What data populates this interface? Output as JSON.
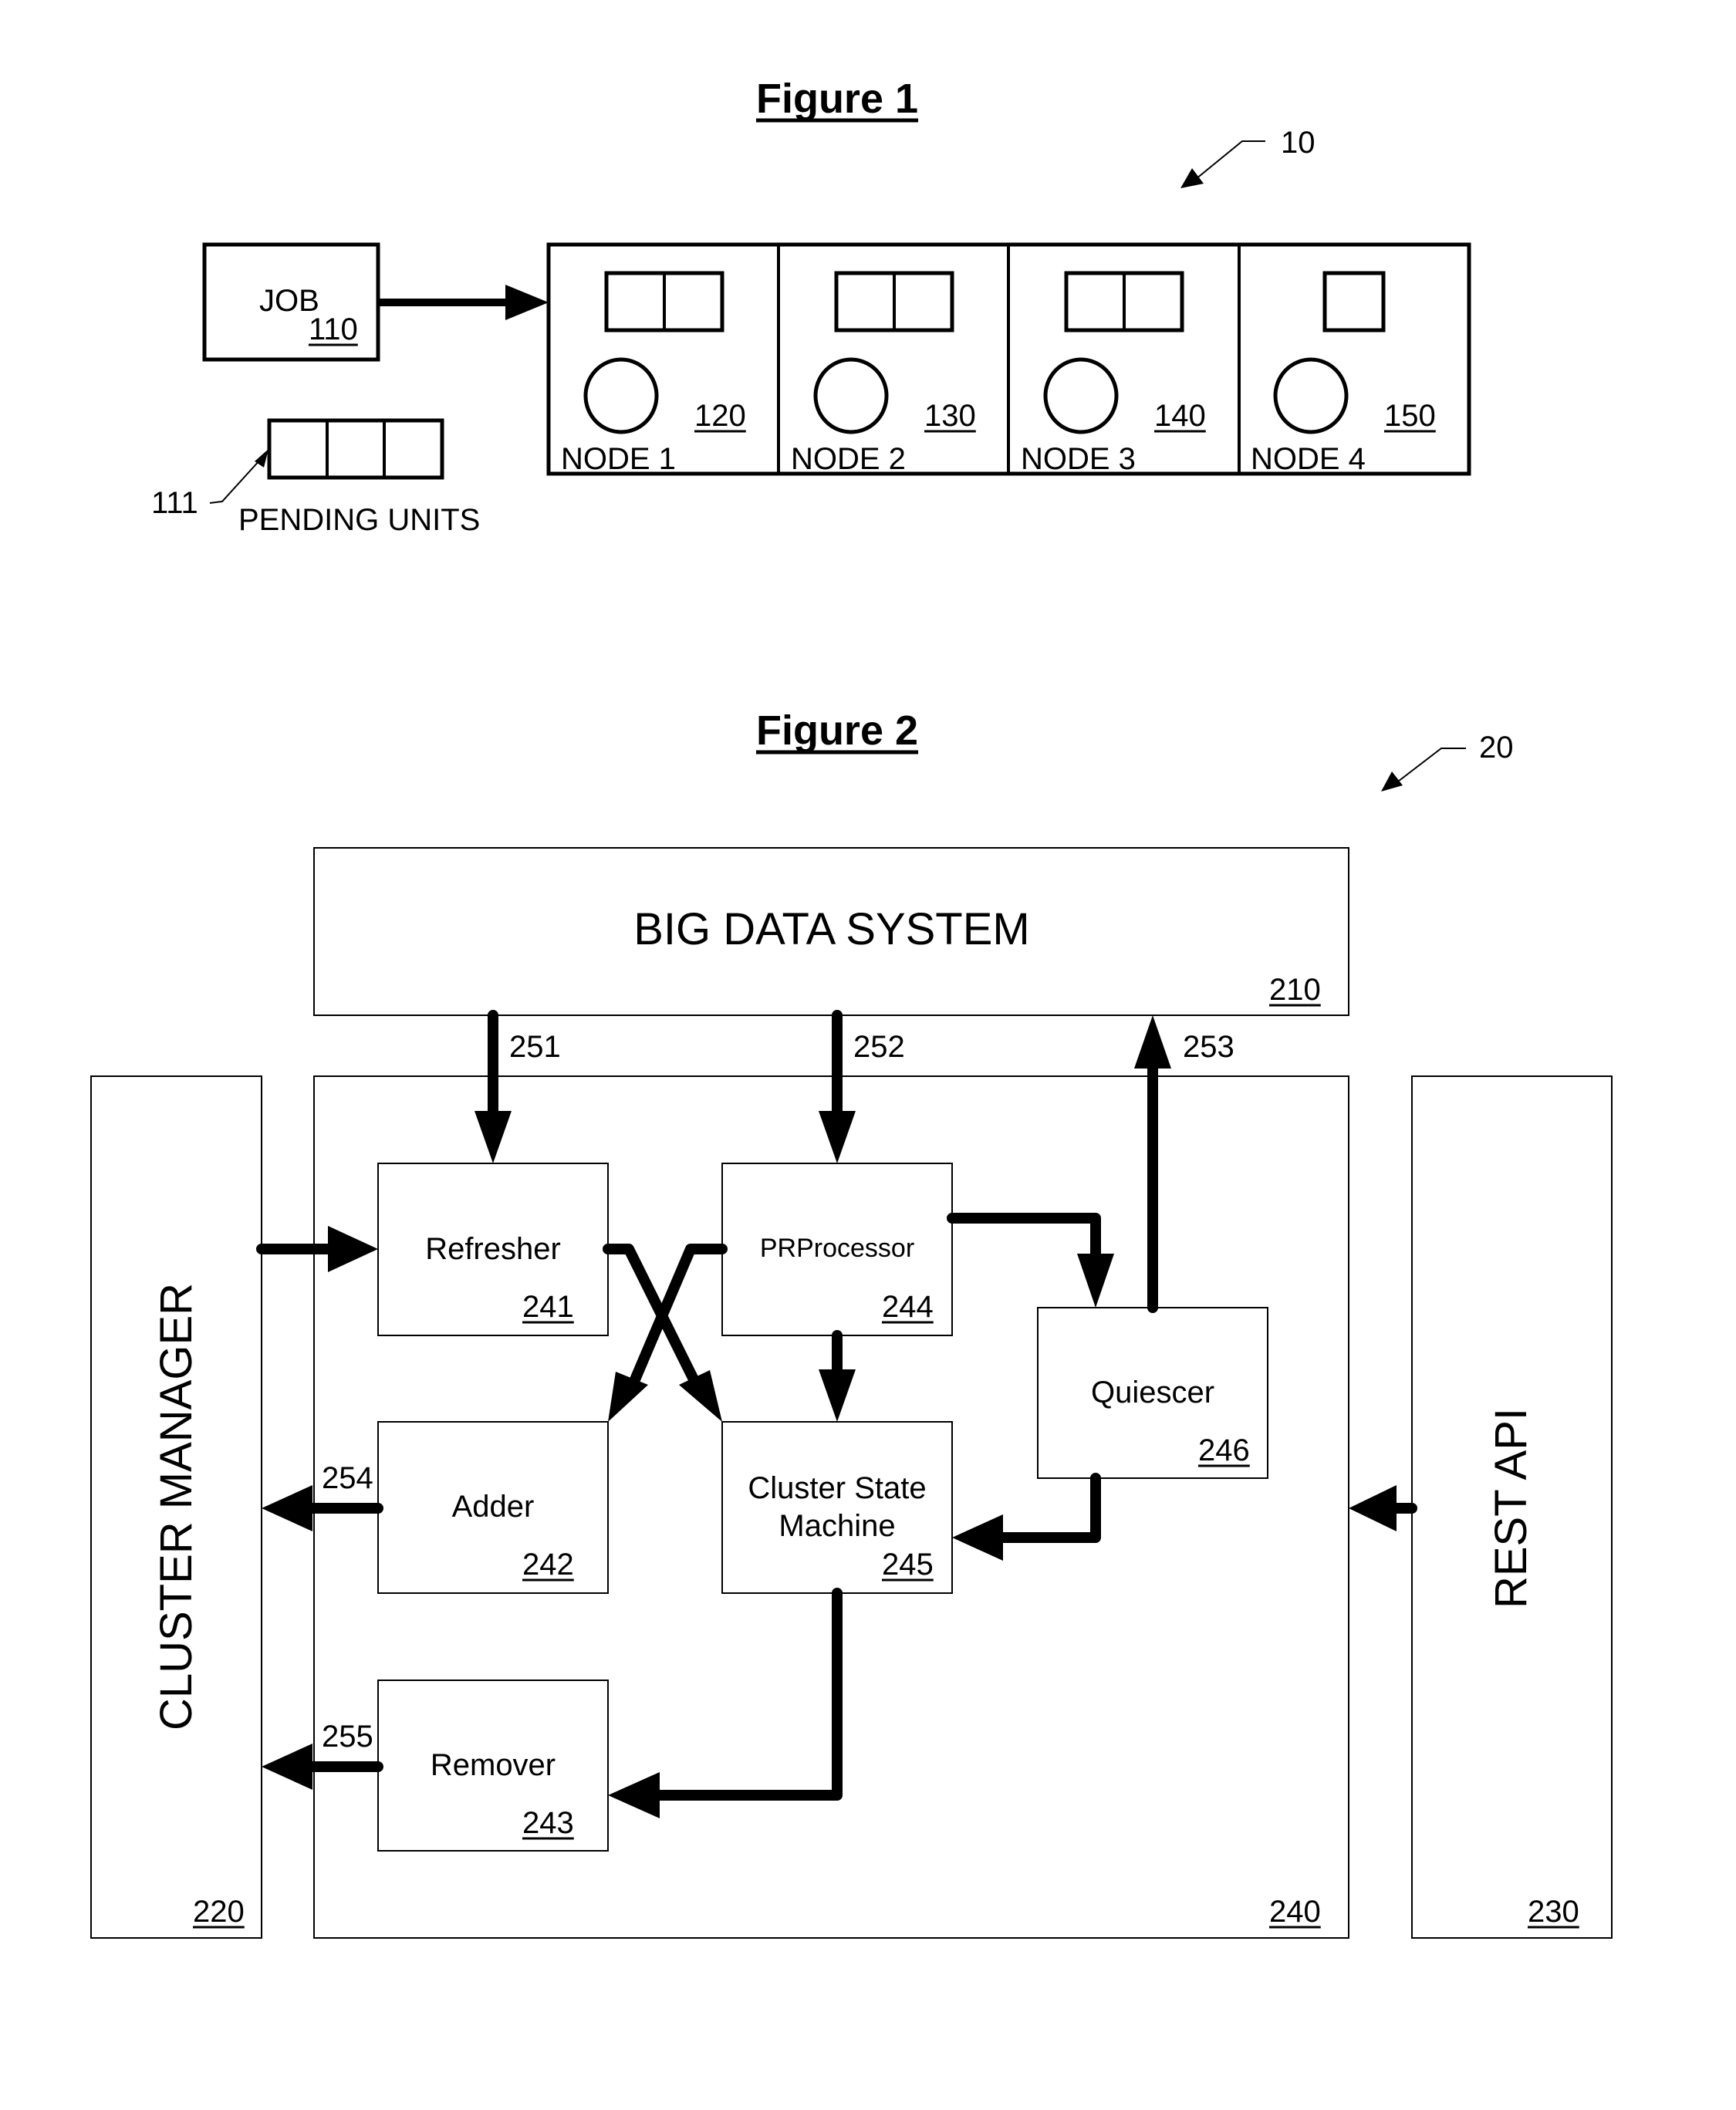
{
  "figure1": {
    "title": "Figure 1",
    "system_ref": "10",
    "job": {
      "label": "JOB",
      "ref": "110"
    },
    "pending": {
      "label": "PENDING UNITS",
      "ref": "111",
      "unit_count": 3
    },
    "nodes": [
      {
        "label": "NODE 1",
        "ref": "120",
        "unit_count": 2
      },
      {
        "label": "NODE 2",
        "ref": "130",
        "unit_count": 2
      },
      {
        "label": "NODE 3",
        "ref": "140",
        "unit_count": 2
      },
      {
        "label": "NODE 4",
        "ref": "150",
        "unit_count": 1
      }
    ]
  },
  "figure2": {
    "title": "Figure 2",
    "system_ref": "20",
    "big_data_system": {
      "label": "BIG DATA SYSTEM",
      "ref": "210"
    },
    "cluster_manager": {
      "label": "CLUSTER MANAGER",
      "ref": "220"
    },
    "rest_api": {
      "label": "REST API",
      "ref": "230"
    },
    "controller": {
      "ref": "240"
    },
    "components": {
      "refresher": {
        "label": "Refresher",
        "ref": "241"
      },
      "adder": {
        "label": "Adder",
        "ref": "242"
      },
      "remover": {
        "label": "Remover",
        "ref": "243"
      },
      "prprocessor": {
        "label": "PRProcessor",
        "ref": "244"
      },
      "cluster_state_machine": {
        "label_line1": "Cluster State",
        "label_line2": "Machine",
        "ref": "245"
      },
      "quiescer": {
        "label": "Quiescer",
        "ref": "246"
      }
    },
    "flows": {
      "f251": "251",
      "f252": "252",
      "f253": "253",
      "f254": "254",
      "f255": "255"
    }
  }
}
